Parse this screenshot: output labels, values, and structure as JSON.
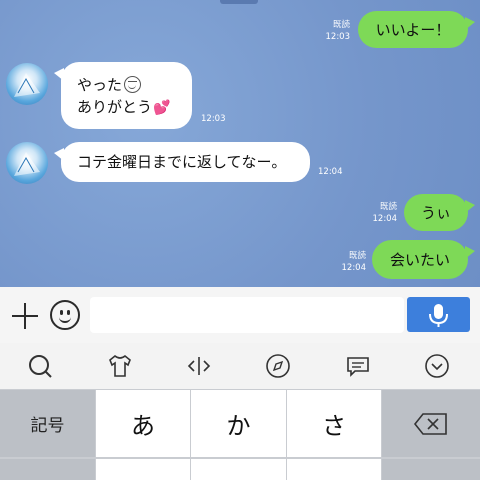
{
  "messages": [
    {
      "id": "m1",
      "dir": "out",
      "text": "いいよー！",
      "read": "既読",
      "time": "12:03"
    },
    {
      "id": "m2",
      "dir": "in",
      "line1": "やった",
      "line2": "ありがとう",
      "time": "12:03"
    },
    {
      "id": "m3",
      "dir": "in",
      "text": "コテ金曜日までに返してなー。",
      "time": "12:04"
    },
    {
      "id": "m4",
      "dir": "out",
      "text": "うぃ",
      "read": "既読",
      "time": "12:04"
    },
    {
      "id": "m5",
      "dir": "out",
      "text": "会いたい",
      "read": "既読",
      "time": "12:04"
    }
  ],
  "input": {
    "placeholder": ""
  },
  "toolbar": [
    "search-icon",
    "tshirt-icon",
    "cursor-move-icon",
    "compass-icon",
    "message-icon",
    "chevron-down-icon"
  ],
  "keyboard": {
    "symbols_label": "記号",
    "key_a": "あ",
    "key_ka": "か",
    "key_sa": "さ",
    "backspace": "⌫"
  },
  "colors": {
    "chat_bg": "#7b9dcf",
    "outgoing_bubble": "#7ed957",
    "incoming_bubble": "#ffffff",
    "mic_button": "#3d7fdc"
  }
}
